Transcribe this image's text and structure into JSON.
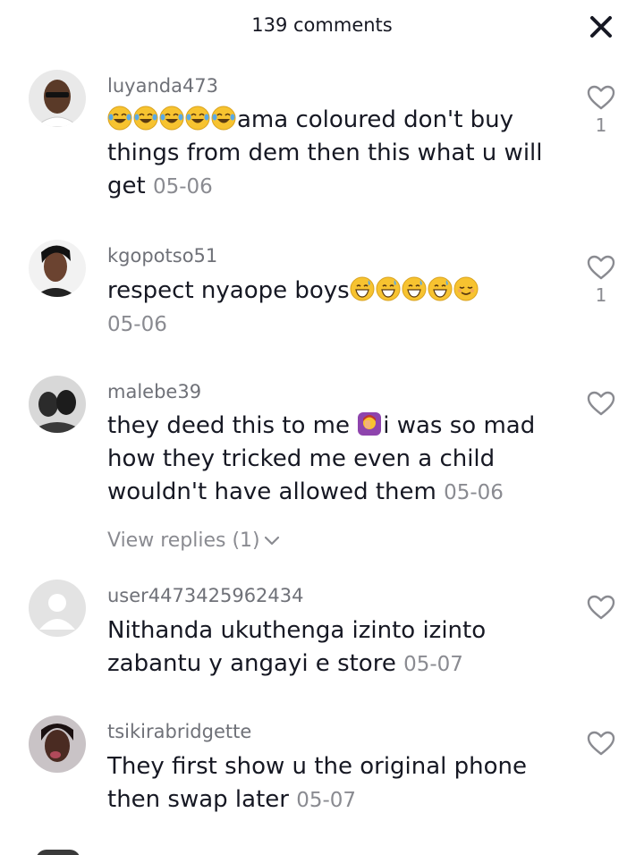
{
  "header": {
    "title": "139 comments",
    "close_icon": "close-icon"
  },
  "comments": [
    {
      "username": "luyanda473",
      "text_pre": "",
      "emojis": [
        "face-with-tears-of-joy",
        "face-with-tears-of-joy",
        "face-with-tears-of-joy",
        "face-with-tears-of-joy",
        "face-with-tears-of-joy"
      ],
      "text": "ama coloured don't buy things from dem then this what u will get",
      "date": "05-06",
      "likes": "1"
    },
    {
      "username": "kgopotso51",
      "text": "respect nyaope boys",
      "emojis": [
        "grinning-face-with-sweat",
        "grinning-face-with-sweat",
        "grinning-face-with-sweat",
        "grinning-face-with-sweat",
        "relieved-face"
      ],
      "date": "05-06",
      "likes": "1"
    },
    {
      "username": "malebe39",
      "text_before": "they deed this to me ",
      "emojis": [
        "woman-facepalming"
      ],
      "text": "i was so mad how they tricked me even a child wouldn't have allowed them",
      "date": "05-06",
      "replies": "View replies (1)"
    },
    {
      "username": "user4473425962434",
      "text": "Nithanda ukuthenga izinto izinto zabantu y angayi e store",
      "date": "05-07"
    },
    {
      "username": "tsikirabridgette",
      "text": "They first show u the original phone then swap later",
      "date": "05-07"
    }
  ],
  "icons": {
    "like": "heart-outline-icon",
    "expand": "chevron-down-icon"
  },
  "colors": {
    "text_primary": "#161823",
    "text_secondary": "#8a8b91",
    "emoji_yellow": "#f7c330"
  }
}
